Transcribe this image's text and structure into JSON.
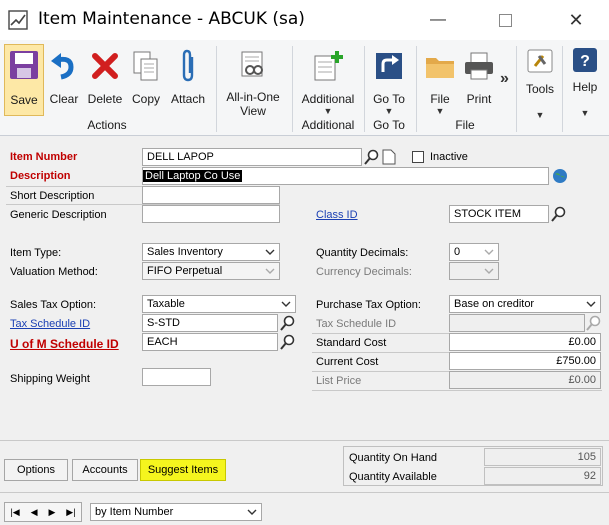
{
  "window": {
    "title": "Item Maintenance  -  ABCUK (sa)",
    "app_icon": "chart-icon"
  },
  "ribbon": {
    "buttons": [
      {
        "label": "Save",
        "icon": "save-icon"
      },
      {
        "label": "Clear",
        "icon": "undo-icon"
      },
      {
        "label": "Delete",
        "icon": "delete-icon"
      },
      {
        "label": "Copy",
        "icon": "copy-icon"
      },
      {
        "label": "Attach",
        "icon": "paperclip-icon"
      },
      {
        "label": "All-in-One\nView",
        "icon": "all-in-one-view-icon"
      },
      {
        "label": "Additional",
        "icon": "additional-icon"
      },
      {
        "label": "Go To",
        "icon": "goto-icon"
      },
      {
        "label": "File",
        "icon": "folder-icon"
      },
      {
        "label": "Print",
        "icon": "printer-icon"
      },
      {
        "label": "Tools",
        "icon": "tools-icon"
      },
      {
        "label": "Help",
        "icon": "help-icon"
      }
    ],
    "groups": [
      "Actions",
      "Additional",
      "Go To",
      "File"
    ],
    "more_glyph": "»"
  },
  "form": {
    "item_number": {
      "label": "Item Number",
      "value": "DELL LAPOP"
    },
    "inactive_label": "Inactive",
    "description": {
      "label": "Description",
      "value": "Dell Laptop Co Use"
    },
    "short_description": {
      "label": "Short Description",
      "value": ""
    },
    "generic_description": {
      "label": "Generic Description",
      "value": ""
    },
    "class_id": {
      "label": "Class ID",
      "value": "STOCK ITEM"
    },
    "item_type": {
      "label": "Item Type:",
      "value": "Sales Inventory"
    },
    "valuation_method": {
      "label": "Valuation Method:",
      "value": "FIFO Perpetual"
    },
    "quantity_decimals": {
      "label": "Quantity Decimals:",
      "value": "0"
    },
    "currency_decimals": {
      "label": "Currency Decimals:",
      "value": ""
    },
    "sales_tax_option": {
      "label": "Sales Tax Option:",
      "value": "Taxable"
    },
    "tax_schedule_id": {
      "label": "Tax Schedule ID",
      "value": "S-STD"
    },
    "uom_schedule_id": {
      "label": "U of M Schedule ID",
      "value": "EACH"
    },
    "purchase_tax_option": {
      "label": "Purchase Tax Option:",
      "value": "Base on creditor"
    },
    "purchase_tax_schedule_id": {
      "label": "Tax Schedule ID",
      "value": ""
    },
    "standard_cost": {
      "label": "Standard Cost",
      "value": "£0.00"
    },
    "current_cost": {
      "label": "Current Cost",
      "value": "£750.00"
    },
    "list_price": {
      "label": "List Price",
      "value": "£0.00"
    },
    "shipping_weight": {
      "label": "Shipping Weight",
      "value": ""
    }
  },
  "footer": {
    "options_label": "Options",
    "accounts_label": "Accounts",
    "suggest_items_label": "Suggest Items",
    "quantity_on_hand": {
      "label": "Quantity On Hand",
      "value": "105"
    },
    "quantity_available": {
      "label": "Quantity Available",
      "value": "92"
    },
    "sort_by": "by Item Number"
  }
}
